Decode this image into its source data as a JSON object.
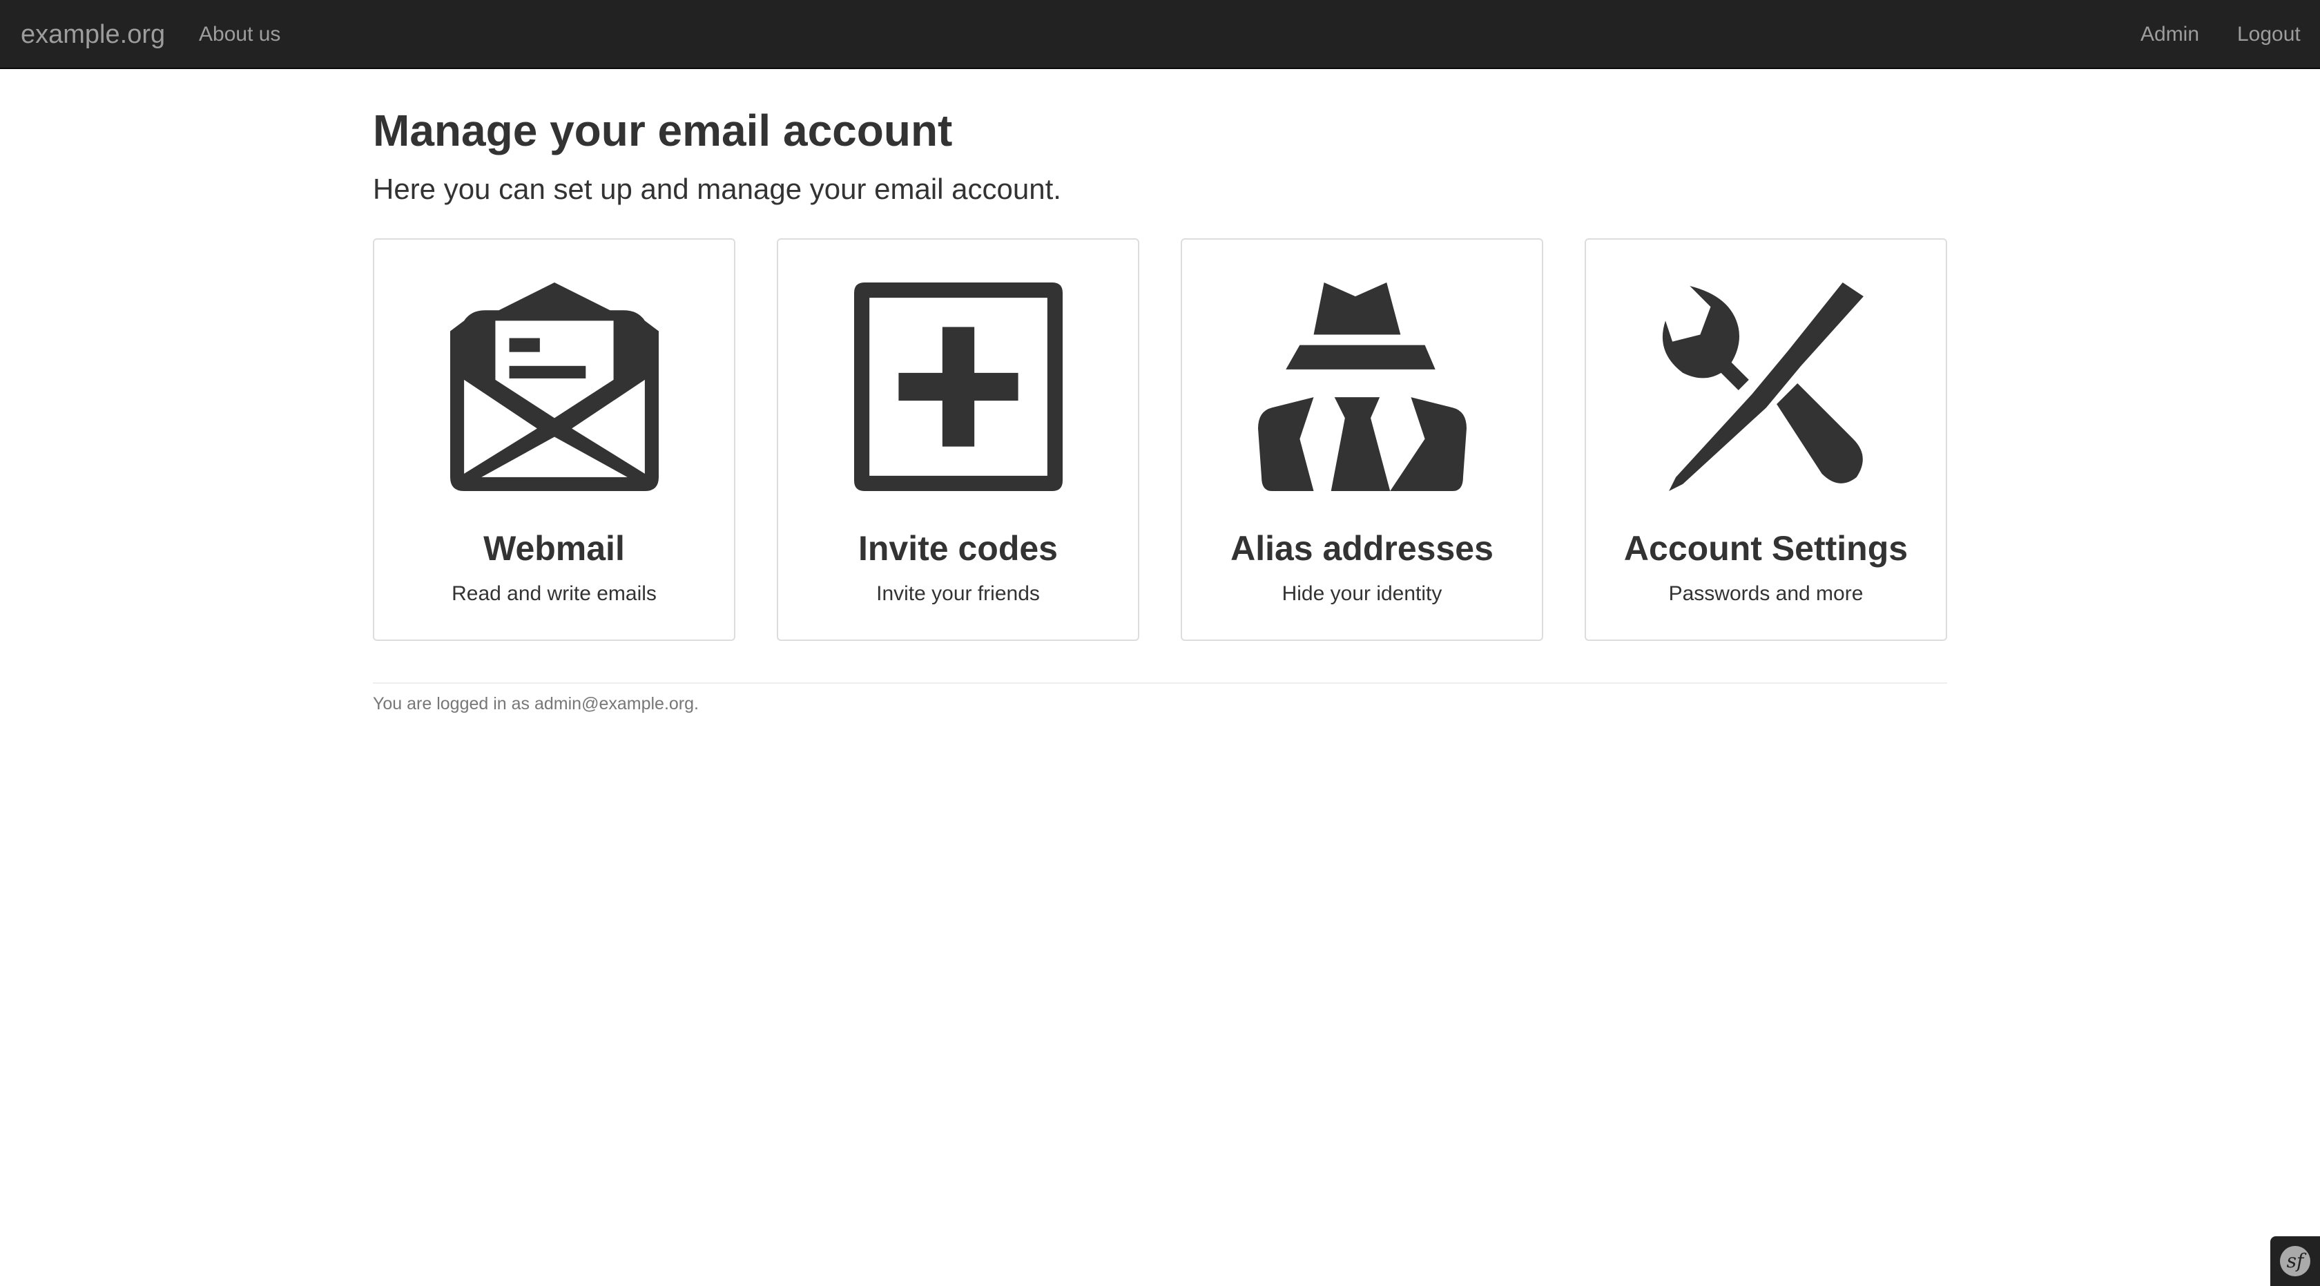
{
  "navbar": {
    "brand": "example.org",
    "about_label": "About us",
    "admin_label": "Admin",
    "logout_label": "Logout"
  },
  "main": {
    "title": "Manage your email account",
    "lead": "Here you can set up and manage your email account.",
    "tiles": [
      {
        "title": "Webmail",
        "description": "Read and write emails",
        "icon": "envelope-open-icon"
      },
      {
        "title": "Invite codes",
        "description": "Invite your friends",
        "icon": "plus-square-icon"
      },
      {
        "title": "Alias addresses",
        "description": "Hide your identity",
        "icon": "incognito-icon"
      },
      {
        "title": "Account Settings",
        "description": "Passwords and more",
        "icon": "wrench-screwdriver-icon"
      }
    ]
  },
  "footer": {
    "logged_in_text": "You are logged in as admin@example.org."
  },
  "debug_toolbar": {
    "icon": "symfony-logo-icon",
    "glyph": "sf"
  },
  "colors": {
    "navbar_bg": "#222222",
    "navbar_text": "#9d9d9d",
    "icon_fill": "#333333",
    "tile_border": "#dddddd"
  }
}
